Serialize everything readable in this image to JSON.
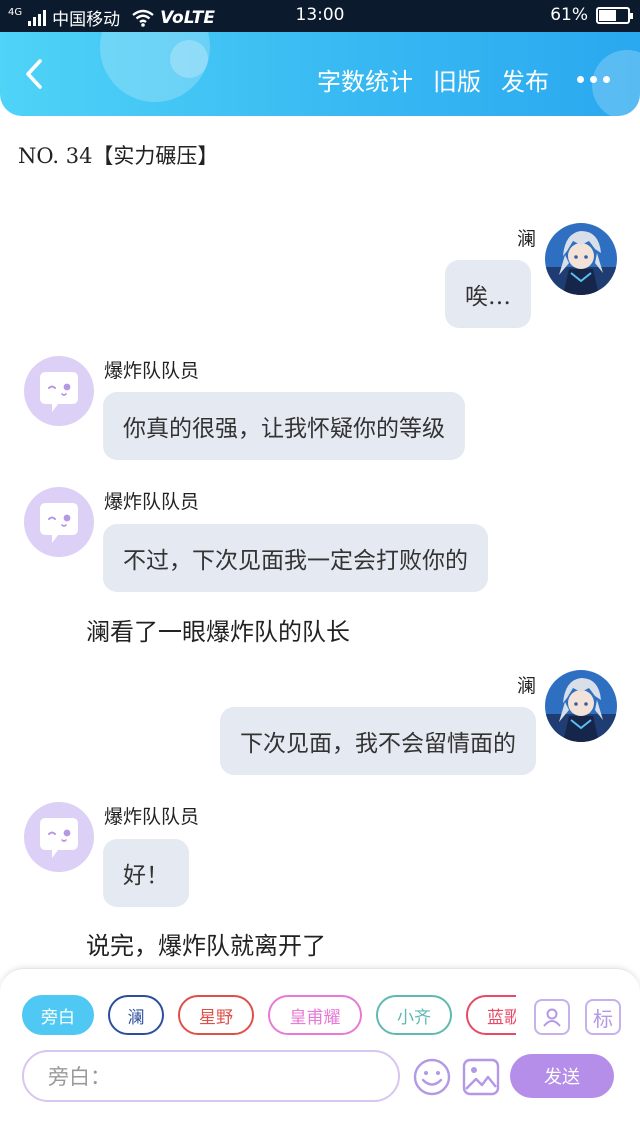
{
  "status_bar": {
    "network": "4G",
    "carrier": "中国移动",
    "volte": "VoLTE",
    "time": "13:00",
    "battery": "61%",
    "battery_level": 0.61
  },
  "header": {
    "actions": [
      "字数统计",
      "旧版",
      "发布"
    ]
  },
  "chapter_title": "NO. 34【实力碾压】",
  "messages": [
    {
      "speaker": "澜",
      "text": "唉…"
    },
    {
      "speaker": "爆炸队队员",
      "text": "你真的很强，让我怀疑你的等级"
    },
    {
      "speaker": "爆炸队队员",
      "text": "不过，下次见面我一定会打败你的"
    },
    {
      "narration": "澜看了一眼爆炸队的队长"
    },
    {
      "speaker": "澜",
      "text": "下次见面，我不会留情面的"
    },
    {
      "speaker": "爆炸队队员",
      "text": "好！"
    },
    {
      "narration": "说完，爆炸队就离开了"
    }
  ],
  "roles": [
    {
      "label": "旁白",
      "color": "#4fc9f4",
      "active": true
    },
    {
      "label": "澜",
      "color": "#2b4f9e"
    },
    {
      "label": "星野",
      "color": "#e0504a"
    },
    {
      "label": "皇甫耀",
      "color": "#e879d6"
    },
    {
      "label": "小齐",
      "color": "#5fb9b2"
    },
    {
      "label": "蓝歌",
      "color": "#e64a68"
    }
  ],
  "role_buttons": {
    "mark": "标"
  },
  "composer": {
    "placeholder": "旁白：",
    "send_label": "发送"
  },
  "colors": {
    "header_gradient": [
      "#4fd3f7",
      "#2aa8f0"
    ],
    "bubble": "#e5e9f2",
    "send": "#b48ee8",
    "npc_avatar": "#ddd0f6"
  }
}
